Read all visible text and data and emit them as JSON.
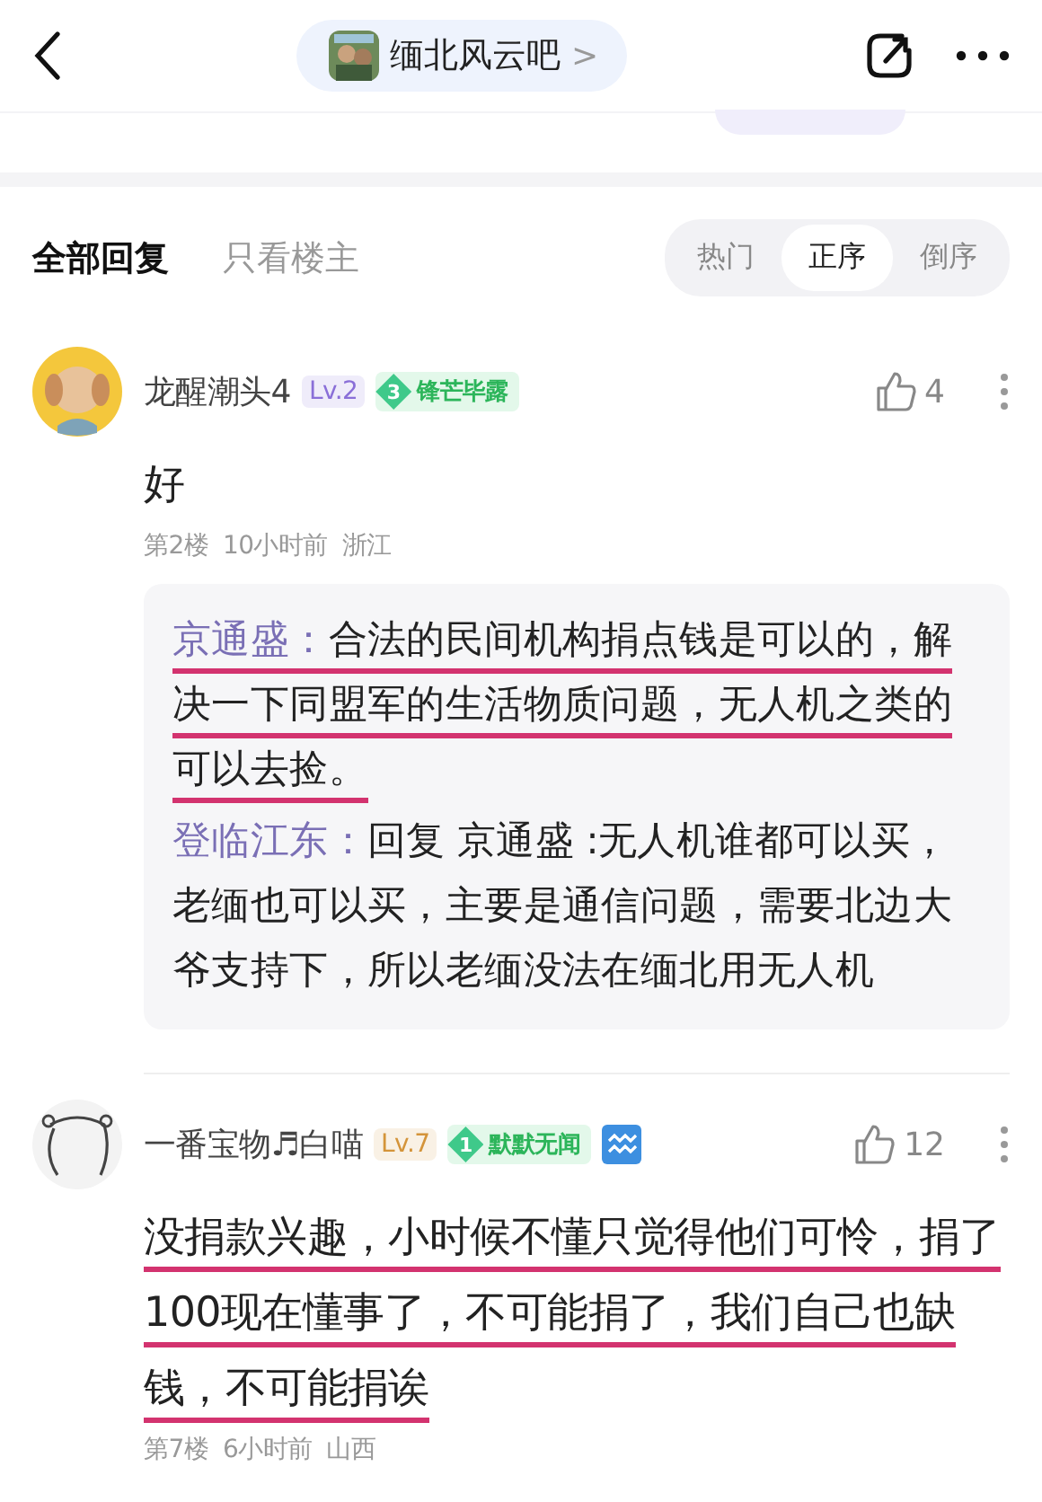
{
  "header": {
    "forum": "缅北风云吧",
    "chevron": ">"
  },
  "reply_tabs": [
    {
      "label": "全部回复",
      "selected": true
    },
    {
      "label": "只看楼主",
      "selected": false
    }
  ],
  "sort": [
    {
      "label": "热门",
      "selected": false
    },
    {
      "label": "正序",
      "selected": true
    },
    {
      "label": "倒序",
      "selected": false
    }
  ],
  "comments": [
    {
      "avatar": {
        "kind": "dog"
      },
      "user": "龙醒潮头4",
      "level": {
        "text": "Lv.2",
        "color": "#8a6fd8"
      },
      "badge_num": "3",
      "badge": "锋芒毕露",
      "extra_icon": false,
      "likes": "4",
      "body": [
        {
          "text": "好",
          "underlined": false
        }
      ],
      "floor": "第2楼",
      "time": "10小时前",
      "region": "浙江",
      "replies": [
        {
          "user": "京通盛：",
          "text": "合法的民间机构捐点钱是可以的，解决一下同盟军的生活物质问题，无人机之类的可以去捡。",
          "underlined": true
        },
        {
          "user": "登临江东：",
          "text": "回复 京通盛 :无人机谁都可以买，老缅也可以买，主要是通信问题，需要北边大爷支持下，所以老缅没法在缅北用无人机",
          "underlined": false
        }
      ]
    },
    {
      "avatar": {
        "kind": "sketch"
      },
      "user": "一番宝物♬白喵",
      "level": {
        "text": "Lv.7",
        "color": "#d4943a"
      },
      "badge_num": "1",
      "badge": "默默无闻",
      "extra_icon": true,
      "likes": "12",
      "body": [
        {
          "text": "没捐款兴趣，小时候不懂只觉得他们可怜，捐了100现在懂事了，不可能捐了，我们自己也缺钱，不可能捐诶",
          "underlined": true
        }
      ],
      "floor": "第7楼",
      "time": "6小时前",
      "region": "山西"
    }
  ]
}
